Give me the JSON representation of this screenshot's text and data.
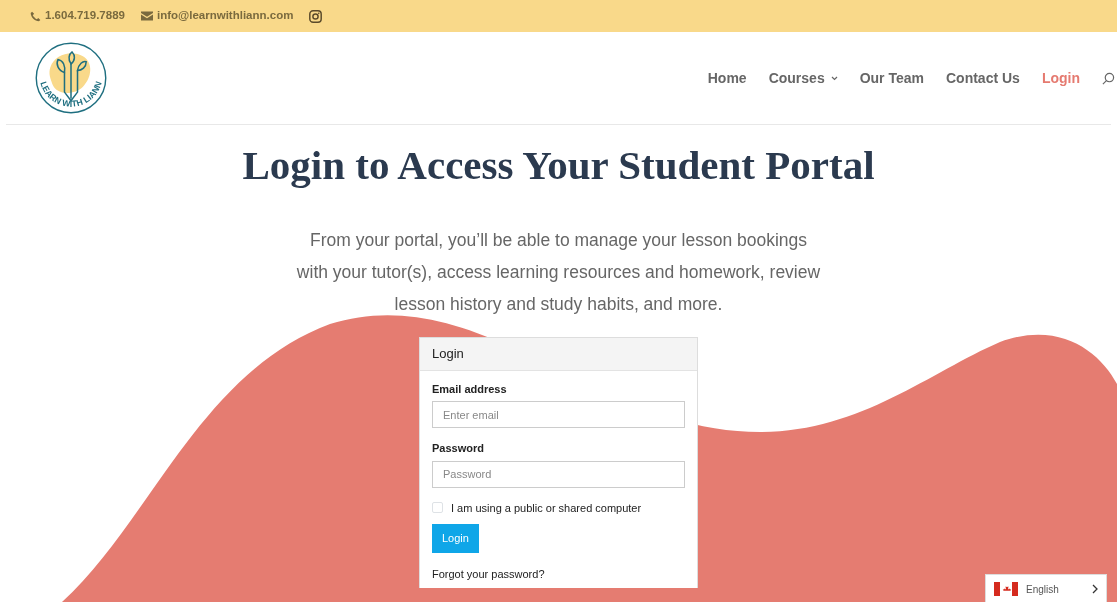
{
  "topbar": {
    "phone": "1.604.719.7889",
    "email": "info@learnwithliann.com"
  },
  "logo": {
    "text": "LEARN WITH LIANN"
  },
  "nav": [
    {
      "label": "Home",
      "selected": false,
      "dropdown": false
    },
    {
      "label": "Courses",
      "selected": false,
      "dropdown": true
    },
    {
      "label": "Our Team",
      "selected": false,
      "dropdown": false
    },
    {
      "label": "Contact Us",
      "selected": false,
      "dropdown": false
    },
    {
      "label": "Login",
      "selected": true,
      "dropdown": false
    }
  ],
  "heading": "Login to Access Your Student Portal",
  "intro": [
    "From your portal, you’ll be able to manage your lesson bookings",
    "with your tutor(s), access learning resources and homework, review",
    "lesson history and study habits, and more."
  ],
  "login_card": {
    "title": "Login",
    "email_label": "Email address",
    "email_placeholder": "Enter email",
    "password_label": "Password",
    "password_placeholder": "Password",
    "shared_computer": {
      "label": "I am using a public or shared computer",
      "checked": false
    },
    "button": "Login",
    "forgot": "Forgot your password?"
  },
  "language": {
    "label": "English"
  }
}
